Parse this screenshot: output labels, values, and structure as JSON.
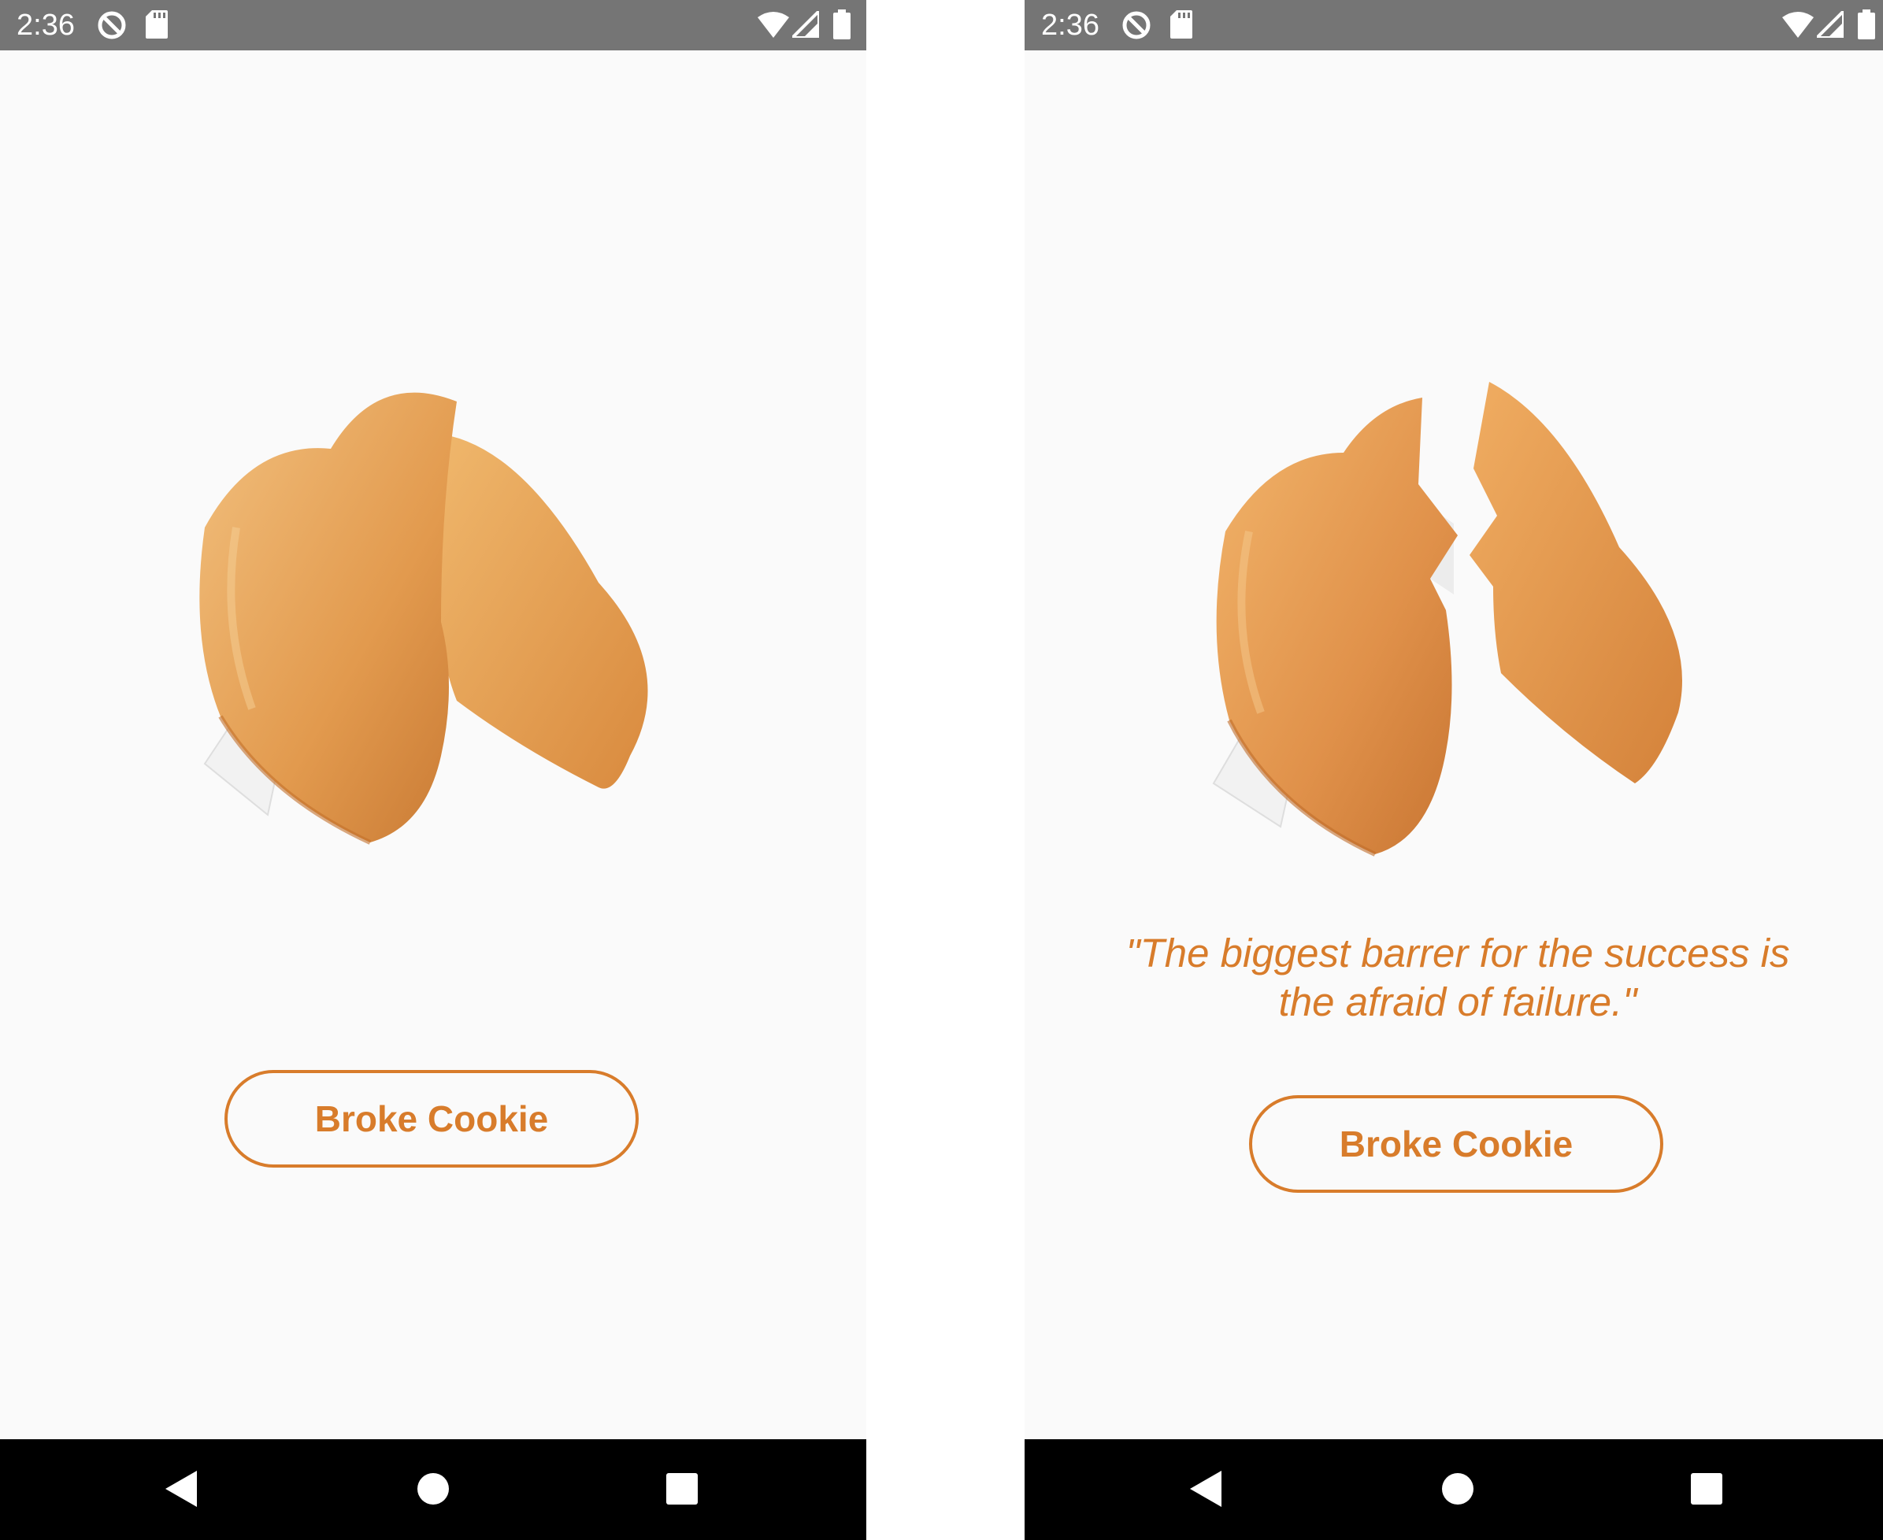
{
  "colors": {
    "accent": "#d87c2b",
    "background": "#fafafa",
    "status_bar": "#757575",
    "nav_bar": "#000000",
    "cookie": "#e7a15a",
    "fortune_paper": "#f2f2f2"
  },
  "screens": [
    {
      "status_bar": {
        "time": "2:36",
        "icons": [
          "do-not-disturb-icon",
          "sd-card-icon",
          "wifi-icon",
          "cell-signal-icon",
          "battery-icon"
        ]
      },
      "cookie_state": "whole",
      "fortune_text": "",
      "button_label": "Broke Cookie",
      "nav_bar": {
        "icons": [
          "back-icon",
          "home-icon",
          "recents-icon"
        ]
      }
    },
    {
      "status_bar": {
        "time": "2:36",
        "icons": [
          "do-not-disturb-icon",
          "sd-card-icon",
          "wifi-icon",
          "cell-signal-icon",
          "battery-icon"
        ]
      },
      "cookie_state": "broken",
      "fortune_text": "\"The biggest barrer for the success is the afraid of failure.\"",
      "fortune_lines": [
        "\"The biggest barrer for the success is",
        "the afraid of failure.\""
      ],
      "button_label": "Broke Cookie",
      "nav_bar": {
        "icons": [
          "back-icon",
          "home-icon",
          "recents-icon"
        ]
      }
    }
  ]
}
